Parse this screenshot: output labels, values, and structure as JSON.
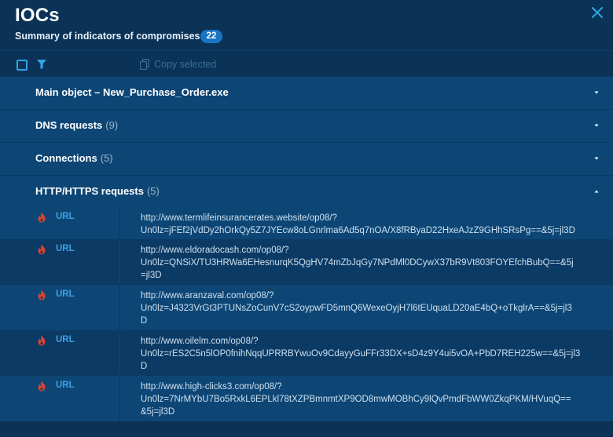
{
  "header": {
    "title": "IOCs",
    "subtitle": "Summary of indicators of compromises",
    "count": "22"
  },
  "toolbar": {
    "copy_label": "Copy selected"
  },
  "sections": [
    {
      "title": "Main object",
      "detail": "New_Purchase_Order.exe",
      "separator": " – ",
      "count": "",
      "expanded": false
    },
    {
      "title": "DNS requests",
      "count": "(9)",
      "expanded": false
    },
    {
      "title": "Connections",
      "count": "(5)",
      "expanded": false
    },
    {
      "title": "HTTP/HTTPS requests",
      "count": "(5)",
      "expanded": true
    }
  ],
  "http_requests": [
    {
      "type": "URL",
      "value": "http://www.termlifeinsurancerates.website/op08/?\nUn0lz=jFEf2jVdDy2hOrkQy5Z7JYEcw8oLGnrlma6Ad5q7nOA/X8fRByaD22HxeAJzZ9GHhSRsPg==&5j=jl3D"
    },
    {
      "type": "URL",
      "value": "http://www.eldoradocash.com/op08/?\nUn0lz=QNSiX/TU3HRWa6EHesnurqK5QgHV74mZbJqGy7NPdMl0DCywX37bR9Vt803FOYEfchBubQ==&5j\n=jl3D"
    },
    {
      "type": "URL",
      "value": "http://www.aranzaval.com/op08/?\nUn0lz=J4323VrGt3PTUNsZoCunV7cS2oypwFD5mnQ6WexeOyjH7l6tEUquaLD20aE4bQ+oTkglrA==&5j=jl3\nD"
    },
    {
      "type": "URL",
      "value": "http://www.oilelm.com/op08/?\nUn0lz=rES2C5n5lOP0fnihNqqUPRRBYwuOv9CdayyGuFFr33DX+sD4z9Y4ui5vOA+PbD7REH225w==&5j=jl3\nD"
    },
    {
      "type": "URL",
      "value": "http://www.high-clicks3.com/op08/?\nUn0lz=7NrMYbU7Bo5RxkL6EPLkl78tXZPBmnmtXP9OD8mwMOBhCy9lQvPmdFbWW0ZkqPKM/HVuqQ==\n&5j=jl3D"
    }
  ],
  "colors": {
    "background": "#0b3358",
    "section": "#0d4675",
    "accent": "#33a4e6",
    "badge": "#1a74c4",
    "danger": "#e0412e"
  },
  "icons": {
    "close": "close-icon",
    "select_all": "checkbox-icon",
    "filter": "filter-icon",
    "copy": "copy-icon",
    "collapsed": "chevron-down-icon",
    "expanded": "chevron-up-icon",
    "threat": "fire-icon"
  }
}
